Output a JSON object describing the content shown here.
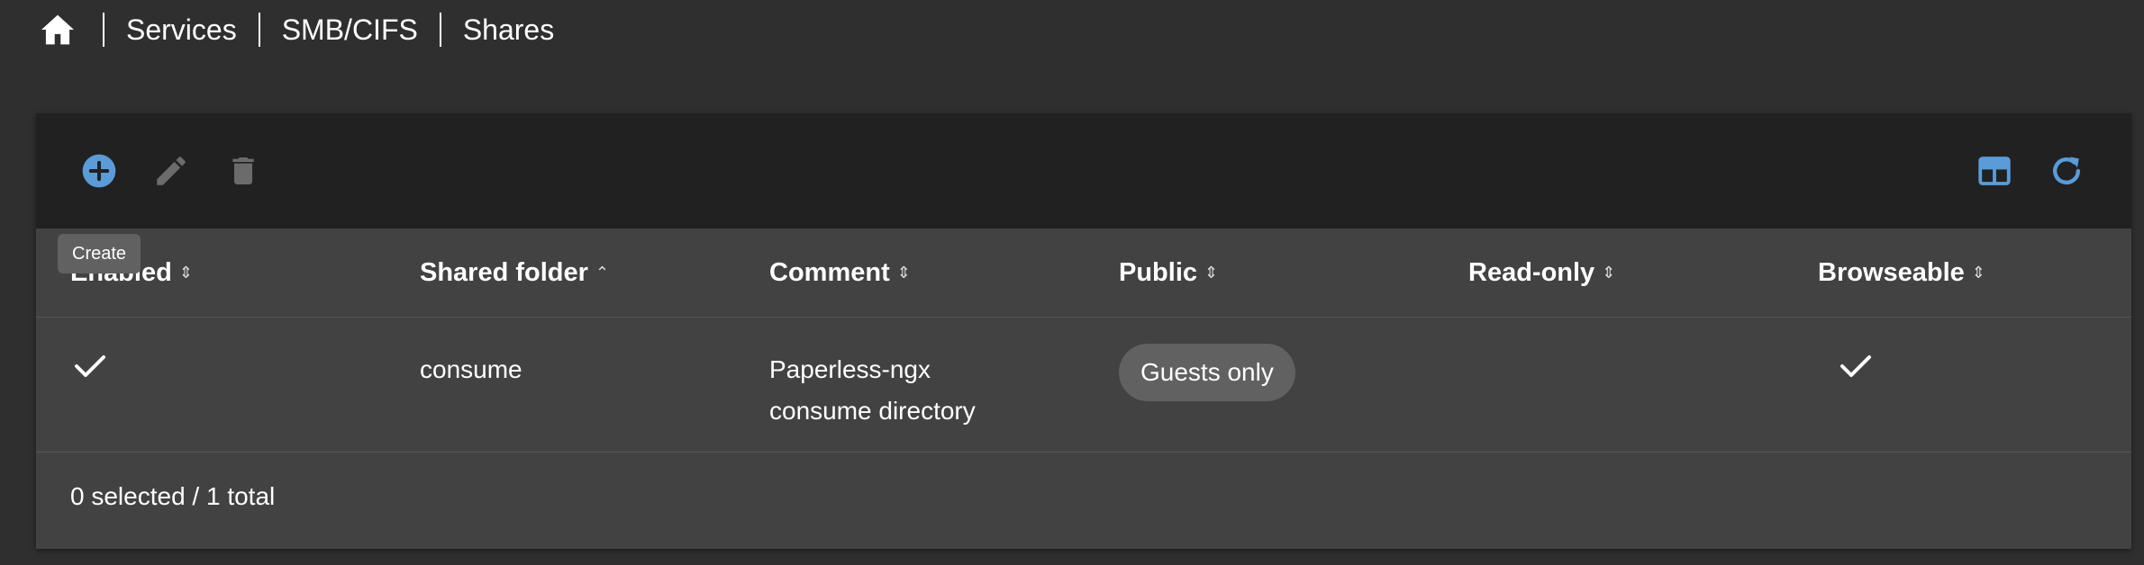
{
  "breadcrumb": {
    "home_icon": "home-icon",
    "items": [
      "Services",
      "SMB/CIFS",
      "Shares"
    ]
  },
  "toolbar": {
    "create_icon": "add-circle-icon",
    "edit_icon": "pencil-icon",
    "delete_icon": "trash-icon",
    "table_settings_icon": "table-icon",
    "reload_icon": "refresh-icon",
    "tooltip": "Create",
    "accent_color": "#5a9bd8",
    "disabled_color": "#6b6b6b"
  },
  "table": {
    "columns": [
      {
        "label": "Enabled",
        "sort": "sortable"
      },
      {
        "label": "Shared folder",
        "sort": "ascending"
      },
      {
        "label": "Comment",
        "sort": "sortable"
      },
      {
        "label": "Public",
        "sort": "sortable"
      },
      {
        "label": "Read-only",
        "sort": "sortable"
      },
      {
        "label": "Browseable",
        "sort": "sortable"
      }
    ],
    "rows": [
      {
        "enabled": "check-icon",
        "shared_folder": "consume",
        "comment_line1": "Paperless-ngx",
        "comment_line2": "consume directory",
        "public": "Guests only",
        "read_only": "",
        "browseable": "check-icon"
      }
    ]
  },
  "footer": {
    "summary": "0 selected / 1 total"
  }
}
